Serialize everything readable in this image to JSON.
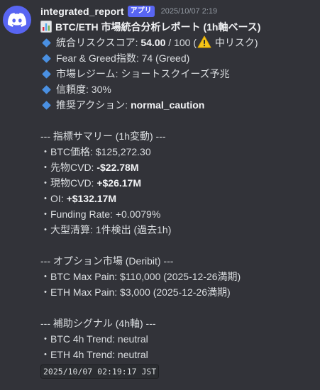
{
  "message": {
    "username": "integrated_report",
    "badge": "アプリ",
    "timestamp": "2025/10/07 2:19",
    "title": "BTC/ETH 市場統合分析レポート (1h軸ベース)",
    "score_line": {
      "label": "統合リスクスコア: ",
      "value": "54.00",
      "total": " / 100 (",
      "level": " 中リスク)"
    },
    "fear_greed": "Fear & Greed指数: 74 (Greed)",
    "regime": "市場レジーム: ショートスクイーズ予兆",
    "confidence": "信頼度: 30%",
    "action": {
      "label": "推奨アクション: ",
      "value": "normal_caution"
    },
    "indicator_header": "--- 指標サマリー (1h変動) ---",
    "btc_price": "・BTC価格: $125,272.30",
    "futures_cvd": {
      "label": "・先物CVD: ",
      "value": "-$22.78M"
    },
    "spot_cvd": {
      "label": "・現物CVD: ",
      "value": "+$26.17M"
    },
    "oi": {
      "label": "・OI: ",
      "value": "+$132.17M"
    },
    "funding": "・Funding Rate: +0.0079%",
    "liquidation": "・大型清算: 1件検出 (過去1h)",
    "options_header": "--- オプション市場 (Deribit) ---",
    "btc_maxpain": "・BTC Max Pain: $110,000 (2025-12-26満期)",
    "eth_maxpain": "・ETH Max Pain: $3,000 (2025-12-26満期)",
    "signal_header": "--- 補助シグナル (4h軸) ---",
    "btc_trend": "・BTC 4h Trend: neutral",
    "eth_trend": "・ETH 4h Trend: neutral",
    "footer_time": "2025/10/07 02:19:17 JST"
  },
  "icons": {
    "avatar": "discord-logo-icon",
    "title": "bar-chart-icon",
    "warning": "warning-icon",
    "bullet": "blue-diamond-icon"
  },
  "colors": {
    "background": "#323339",
    "avatar": "#5865f2",
    "badge": "#5865f2",
    "diamond": "#4a90e2",
    "warning": "#f5c518"
  }
}
